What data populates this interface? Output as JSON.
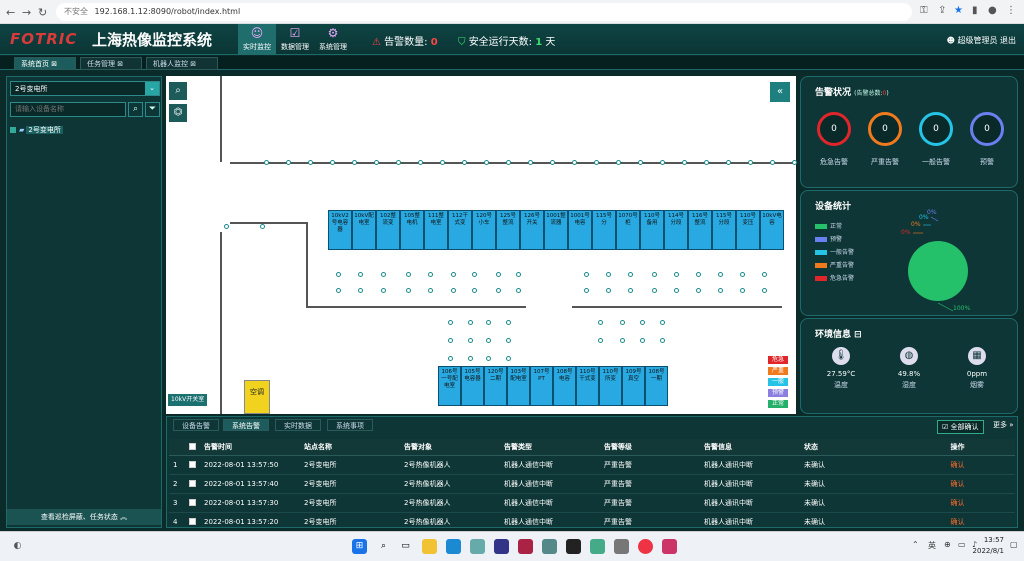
{
  "browser": {
    "security": "不安全",
    "url": "192.168.1.12:8090/robot/index.html"
  },
  "header": {
    "logo": "FOTRIC",
    "title": "上海热像监控系统",
    "nav": [
      {
        "label": "实时监控"
      },
      {
        "label": "数据管理"
      },
      {
        "label": "系统管理"
      }
    ],
    "alarm_label": "告警数量:",
    "alarm_count": "0",
    "safe_label": "安全运行天数:",
    "safe_days": "1",
    "safe_unit": "天",
    "user_label": "超级管理员",
    "logout": "退出"
  },
  "tabs": [
    {
      "label": "系统首页"
    },
    {
      "label": "任务管理"
    },
    {
      "label": "机器人监控"
    }
  ],
  "sidebar": {
    "station": "2号变电所",
    "search_placeholder": "请输入设备名称",
    "tree_item": "2号变电所",
    "bottom_label": "查看巡检屏蔽、任务状态"
  },
  "map": {
    "devices_top": [
      "10kV2号电容器",
      "10kV配电室",
      "102整流变",
      "105整电机",
      "111整电室",
      "112干式变",
      "120号小车",
      "125号整流",
      "126号开关",
      "1001整流器",
      "1001号电容",
      "115号分",
      "1070号柜",
      "110号备用",
      "114号分段",
      "116号整流",
      "115号分段",
      "110号变压",
      "10kV电容"
    ],
    "devices_bottom": [
      "106号一号配电室",
      "105号电容器",
      "120号二期",
      "103号配电室",
      "107号PT",
      "108号电容",
      "110号干式变",
      "110号所变",
      "109号真空",
      "108号一期"
    ],
    "yellow_label": "空调",
    "switch_label": "10kV开关室",
    "legend": [
      "危急",
      "严重",
      "一般",
      "预警",
      "正常"
    ]
  },
  "alarm_panel": {
    "title": "告警状况",
    "total_label": "(告警总数:",
    "total": "0",
    "total_end": ")",
    "items": [
      {
        "label": "危急告警",
        "count": "0"
      },
      {
        "label": "严重告警",
        "count": "0"
      },
      {
        "label": "一般告警",
        "count": "0"
      },
      {
        "label": "预警",
        "count": "0"
      }
    ]
  },
  "device_panel": {
    "title": "设备统计",
    "legend": [
      "正常",
      "预警",
      "一般告警",
      "严重告警",
      "危急告警"
    ],
    "pct_labels": [
      "0%",
      "0%",
      "0%",
      "0%",
      "100%"
    ]
  },
  "env_panel": {
    "title": "环境信息",
    "items": [
      {
        "value": "27.59°C",
        "label": "温度"
      },
      {
        "value": "49.8%",
        "label": "湿度"
      },
      {
        "value": "0ppm",
        "label": "烟雾"
      }
    ]
  },
  "bottom": {
    "tabs": [
      "设备告警",
      "系统告警",
      "实时数据",
      "系统事项"
    ],
    "confirm_all": "全部确认",
    "more": "更多",
    "columns": [
      "告警时间",
      "站点名称",
      "告警对象",
      "告警类型",
      "告警等级",
      "告警信息",
      "状态",
      "操作"
    ],
    "rows": [
      {
        "no": "1",
        "time": "2022-08-01 13:57:50",
        "site": "2号变电所",
        "obj": "2号热像机器人",
        "type": "机器人通信中断",
        "level": "严重告警",
        "info": "机器人通讯中断",
        "status": "未确认",
        "op": "确认"
      },
      {
        "no": "2",
        "time": "2022-08-01 13:57:40",
        "site": "2号变电所",
        "obj": "2号热像机器人",
        "type": "机器人通信中断",
        "level": "严重告警",
        "info": "机器人通讯中断",
        "status": "未确认",
        "op": "确认"
      },
      {
        "no": "3",
        "time": "2022-08-01 13:57:30",
        "site": "2号变电所",
        "obj": "2号热像机器人",
        "type": "机器人通信中断",
        "level": "严重告警",
        "info": "机器人通讯中断",
        "status": "未确认",
        "op": "确认"
      },
      {
        "no": "4",
        "time": "2022-08-01 13:57:20",
        "site": "2号变电所",
        "obj": "2号热像机器人",
        "type": "机器人通信中断",
        "level": "严重告警",
        "info": "机器人通讯中断",
        "status": "未确认",
        "op": "确认"
      }
    ]
  },
  "taskbar": {
    "lang": "英",
    "time": "13:57",
    "date": "2022/8/1"
  },
  "colors": {
    "ring": [
      "#e0262a",
      "#f07a1e",
      "#25c4e6",
      "#6a7ff0"
    ],
    "legend": [
      "#24c06a",
      "#6a7ff0",
      "#25c4e6",
      "#f07a1e",
      "#e0262a"
    ],
    "map_legend": [
      "#e0262a",
      "#f07a1e",
      "#25c4e6",
      "#8a7fe0",
      "#24b06a"
    ]
  },
  "device_stats": {
    "normal_fraction": 1.0
  }
}
